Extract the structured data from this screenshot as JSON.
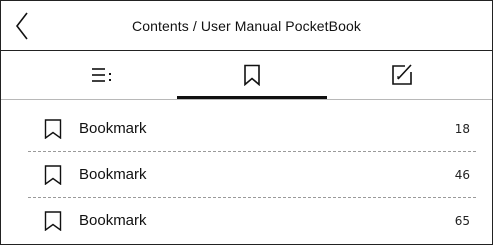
{
  "header": {
    "title": "Contents / User Manual PocketBook"
  },
  "tabs": [
    {
      "name": "contents",
      "icon": "list-icon",
      "active": false
    },
    {
      "name": "bookmarks",
      "icon": "bookmark-icon",
      "active": true
    },
    {
      "name": "notes",
      "icon": "edit-note-icon",
      "active": false
    }
  ],
  "bookmarks": [
    {
      "label": "Bookmark",
      "page": "18"
    },
    {
      "label": "Bookmark",
      "page": "46"
    },
    {
      "label": "Bookmark",
      "page": "65"
    }
  ],
  "colors": {
    "text": "#111111",
    "divider": "#b8b8b8",
    "dashed_separator": "#9a9a9a",
    "active_tab_underline": "#111111"
  }
}
